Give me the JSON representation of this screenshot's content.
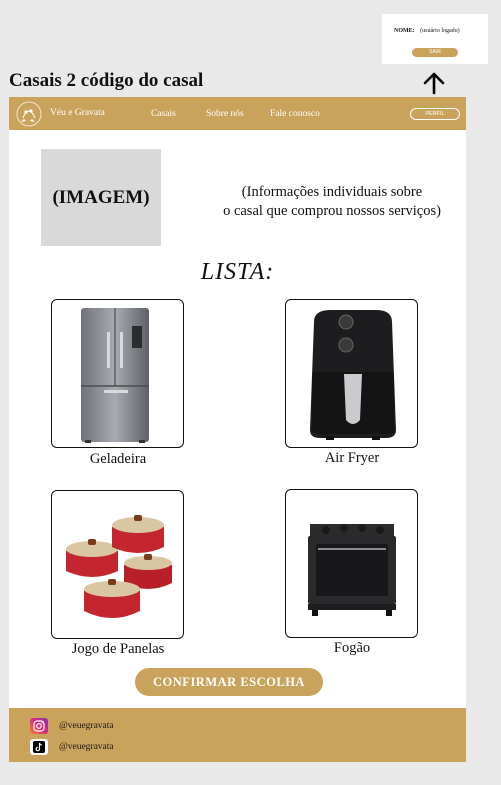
{
  "login": {
    "name_label": "NOME:",
    "name_value": "(usuário logado)",
    "logout_label": "SAIR"
  },
  "page": {
    "heading": "Casais 2 código do casal"
  },
  "nav": {
    "brand": "Véu e Gravata",
    "links": [
      "Casais",
      "Sobre nós",
      "Fale conosco"
    ],
    "profile_label": "PERFIL"
  },
  "couple": {
    "image_placeholder": "(IMAGEM)",
    "info_line1": "(Informações individuais sobre",
    "info_line2": "o casal que comprou nossos serviços)"
  },
  "list": {
    "title": "LISTA:",
    "items": [
      {
        "name": "Geladeira",
        "icon": "refrigerator-icon"
      },
      {
        "name": "Air Fryer",
        "icon": "air-fryer-icon"
      },
      {
        "name": "Jogo de Panelas",
        "icon": "cookware-set-icon"
      },
      {
        "name": "Fogão",
        "icon": "stove-icon"
      }
    ]
  },
  "actions": {
    "confirm_label": "CONFIRMAR ESCOLHA"
  },
  "footer": {
    "instagram_handle": "@veuegravata",
    "tiktok_handle": "@veuegravata"
  },
  "colors": {
    "accent": "#c9a25c",
    "background": "#e9e9e9",
    "placeholder": "#d9d9d9"
  }
}
